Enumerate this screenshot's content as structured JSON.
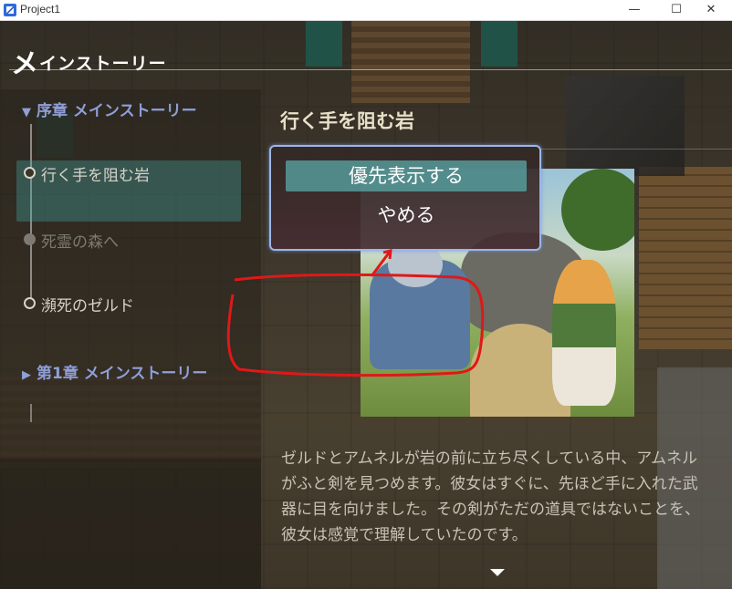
{
  "window": {
    "title": "Project1",
    "minimize_label": "—",
    "maximize_label": "☐",
    "close_label": "✕"
  },
  "menu": {
    "header_initial": "メ",
    "header_rest": "インストーリー"
  },
  "quest_list": {
    "chapter0": "序章 メインストーリー",
    "chapter1": "第1章 メインストーリー",
    "items": [
      "行く手を阻む岩",
      "死霊の森へ",
      "瀕死のゼルド"
    ]
  },
  "detail": {
    "title": "行く手を阻む岩",
    "text": "ゼルドとアムネルが岩の前に立ち尽くしている中、アムネルがふと剣を見つめます。彼女はすぐに、先ほど手に入れた武器に目を向けました。その剣がただの道具ではないことを、彼女は感覚で理解していたのです。"
  },
  "popup": {
    "option_priority": "優先表示する",
    "option_cancel": "やめる"
  },
  "colors": {
    "annotation": "#e01818",
    "popup_border": "#9cb6e8",
    "selection": "#5aaaaa"
  }
}
